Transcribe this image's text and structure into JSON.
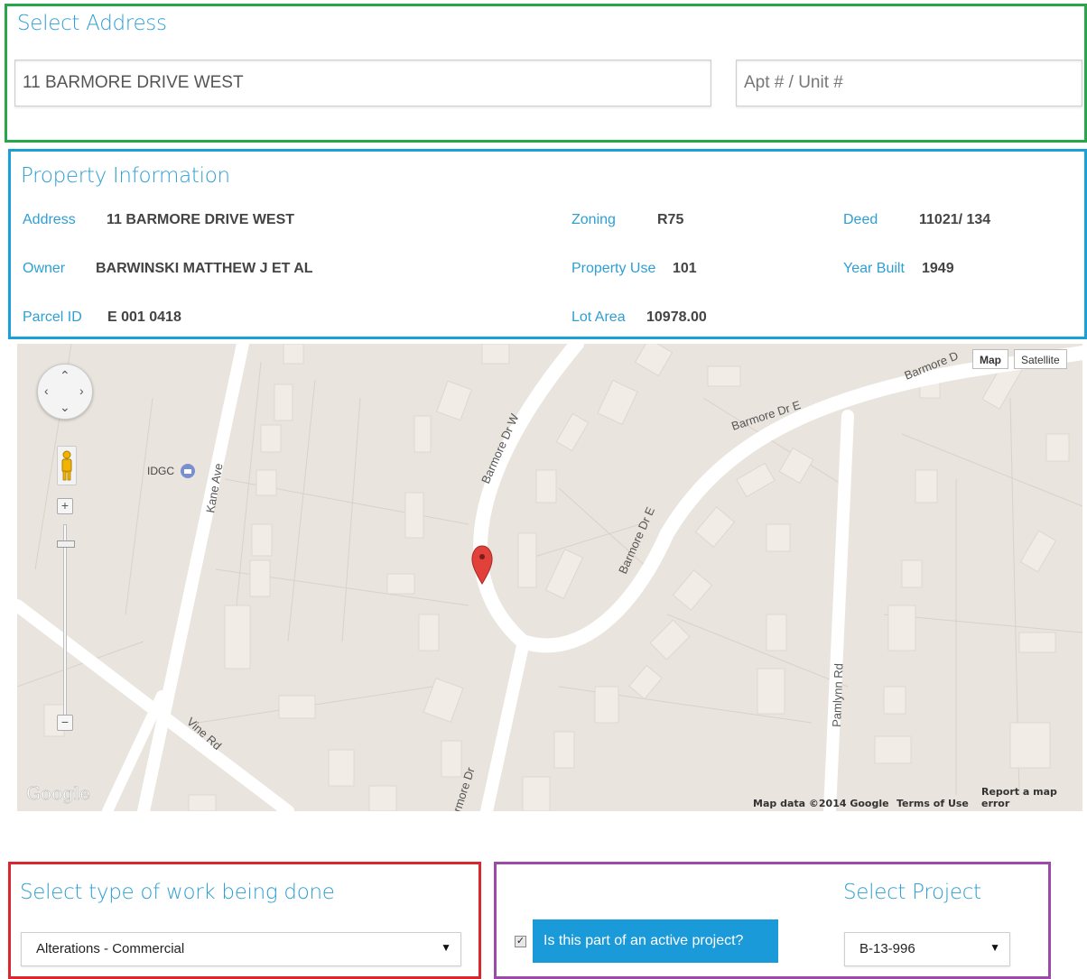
{
  "select_address": {
    "heading": "Select Address",
    "street_value": "11 BARMORE DRIVE WEST",
    "apt_placeholder": "Apt # / Unit #"
  },
  "property_information": {
    "heading": "Property Information",
    "address_label": "Address",
    "address_value": "11 BARMORE DRIVE WEST",
    "owner_label": "Owner",
    "owner_value": "BARWINSKI MATTHEW J ET AL",
    "parcel_label": "Parcel ID",
    "parcel_value": "E 001 0418",
    "zoning_label": "Zoning",
    "zoning_value": "R75",
    "use_label": "Property Use",
    "use_value": "101",
    "lot_label": "Lot Area",
    "lot_value": "10978.00",
    "deed_label": "Deed",
    "deed_value": "11021/ 134",
    "year_label": "Year Built",
    "year_value": "1949"
  },
  "map": {
    "type_map": "Map",
    "type_satellite": "Satellite",
    "logo": "Google",
    "attribution": "Map data ©2014 Google",
    "terms": "Terms of Use",
    "report": "Report a map error",
    "poi_label": "IDGC",
    "streets": {
      "kane_ave": "Kane Ave",
      "barmore_dr_w": "Barmore Dr W",
      "barmore_dr_e_upper": "Barmore Dr E",
      "barmore_dr_e_lower": "Barmore Dr E",
      "barmore_top": "Barmore D",
      "pamlynn_rd": "Pamlynn Rd",
      "vine_rd": "Vine Rd",
      "barmore_dr_bottom": "rmore Dr"
    }
  },
  "work_type": {
    "heading": "Select type of work being done",
    "selected": "Alterations - Commercial"
  },
  "project": {
    "active_project_checked": true,
    "active_project_label": "Is this part of an active project?",
    "heading": "Select Project",
    "selected": "B-13-996"
  },
  "colors": {
    "select_address_border": "#2aa64a",
    "property_border": "#1aa0d9",
    "work_type_border": "#d9262f",
    "project_border": "#9b4aa8",
    "heading": "#2e9fd3",
    "button": "#1a9ad9"
  },
  "icons": {
    "pan": "pan-control-icon",
    "pegman": "pegman-icon",
    "marker": "map-marker-icon",
    "poi": "poi-icon",
    "dropdown": "dropdown-arrow-icon",
    "checkbox": "checkbox-icon"
  }
}
